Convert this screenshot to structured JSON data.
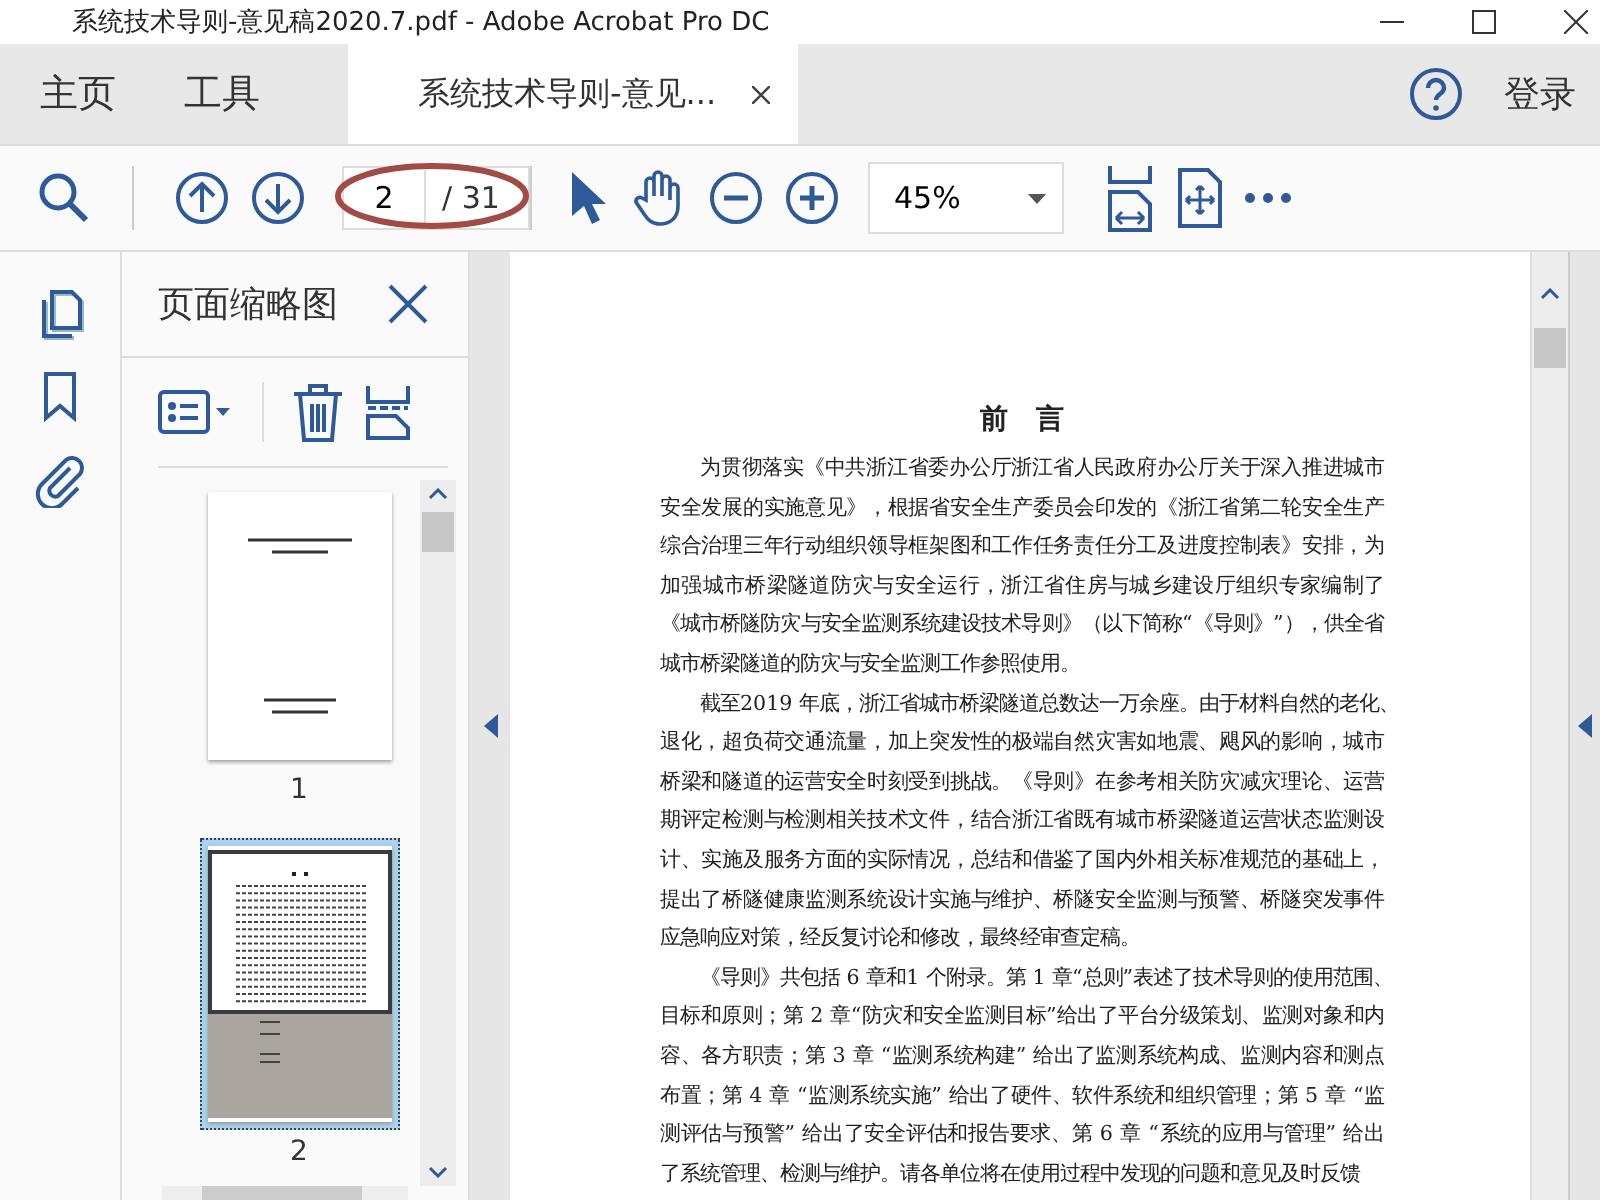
{
  "window": {
    "title": "系统技术导则-意见稿2020.7.pdf - Adobe Acrobat Pro DC"
  },
  "tabs": [
    {
      "label": "主页",
      "kind": "nav",
      "selected": false
    },
    {
      "label": "工具",
      "kind": "nav",
      "selected": false
    },
    {
      "label": "系统技术导则-意见...",
      "kind": "document",
      "selected": true
    }
  ],
  "account": {
    "login": "登录"
  },
  "toolbar": {
    "page_number": "2",
    "page_total": "/ 31",
    "zoom": "45%"
  },
  "sidebar": {
    "title": "页面缩略图",
    "items": [
      {
        "selected": true
      },
      {
        "selected": false
      },
      {
        "selected": false
      }
    ],
    "thumbnails": [
      {
        "label": "1",
        "selected": false
      },
      {
        "label": "2",
        "selected": true
      }
    ]
  },
  "document": {
    "heading": "前　言",
    "paragraphs": [
      {
        "lines": [
          "为贯彻落实《中共浙江省委办公厅浙江省人民政府办公厅关于深入推进城市",
          "安全发展的实施意见》，根据省安全生产委员会印发的《浙江省第二轮安全生产",
          "综合治理三年行动组织领导框架图和工作任务责任分工及进度控制表》安排，为",
          "加强城市桥梁隧道防灾与安全运行，浙江省住房与城乡建设厅组织专家编制了",
          "《城市桥隧防灾与安全监测系统建设技术导则》（以下简称“《导则》”），供全省",
          "城市桥梁隧道的防灾与安全监测工作参照使用。"
        ]
      },
      {
        "lines": [
          "截至2019 年底，浙江省城市桥梁隧道总数达一万余座。由于材料自然的老化、",
          "退化，超负荷交通流量，加上突发性的极端自然灾害如地震、飓风的影响，城市",
          "桥梁和隧道的运营安全时刻受到挑战。《导则》在参考相关防灾减灾理论、运营",
          "期评定检测与检测相关技术文件，结合浙江省既有城市桥梁隧道运营状态监测设",
          "计、实施及服务方面的实际情况，总结和借鉴了国内外相关标准规范的基础上，",
          "提出了桥隧健康监测系统设计实施与维护、桥隧安全监测与预警、桥隧突发事件",
          "应急响应对策，经反复讨论和修改，最终经审查定稿。"
        ]
      },
      {
        "lines": [
          "《导则》共包括 6 章和1 个附录。第 1 章“总则”表述了技术导则的使用范围、",
          "目标和原则；第 2 章“防灾和安全监测目标”给出了平台分级策划、监测对象和内",
          "容、各方职责；第 3 章 “监测系统构建” 给出了监测系统构成、监测内容和测点",
          "布置；第 4 章 “监测系统实施” 给出了硬件、软件系统和组织管理；第 5 章 “监",
          "测评估与预警” 给出了安全评估和报告要求、第 6 章 “系统的应用与管理” 给出",
          "了系统管理、检测与维护。请各单位将在使用过程中发现的问题和意见及时反馈"
        ]
      }
    ]
  }
}
